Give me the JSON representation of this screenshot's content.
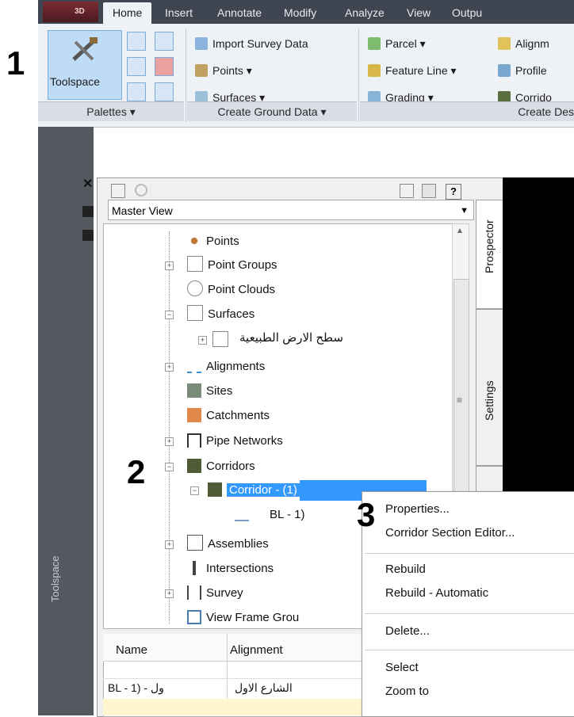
{
  "annotations": {
    "n1": "1",
    "n2": "2",
    "n3": "3"
  },
  "ribbon": {
    "app_badge": "3D",
    "tabs": [
      "Home",
      "Insert",
      "Annotate",
      "Modify",
      "Analyze",
      "View",
      "Outpu"
    ],
    "toolspace_label": "Toolspace",
    "create_ground": [
      "Import Survey Data",
      "Points ▾",
      "Surfaces ▾"
    ],
    "create_design": [
      "Parcel ▾",
      "Feature Line ▾",
      "Grading ▾"
    ],
    "create_design2": [
      "Alignm",
      "Profile",
      "Corrido"
    ],
    "panels": [
      "Palettes ▾",
      "Create Ground Data ▾",
      "Create Des"
    ]
  },
  "toolspace": {
    "strip_label": "Toolspace",
    "view_select": "Master View",
    "side_tabs": [
      "Prospector",
      "Settings"
    ],
    "tree": [
      "Points",
      "Point Groups",
      "Point Clouds",
      "Surfaces",
      "سطح الارض الطبيعية",
      "Alignments",
      "Sites",
      "Catchments",
      "Pipe Networks",
      "Corridors",
      "Corridor - (1)",
      "BL - 1)",
      "Assemblies",
      "Intersections",
      "Survey",
      "View Frame Grou"
    ],
    "grid": {
      "headers": [
        "Name",
        "Alignment"
      ],
      "row": [
        "BL - 1) - ول",
        "الشارع الاول"
      ]
    }
  },
  "context_menu": {
    "items": [
      "Properties...",
      "Corridor Section Editor...",
      "Rebuild",
      "Rebuild - Automatic",
      "Delete...",
      "Select",
      "Zoom to"
    ]
  },
  "colors": {
    "selection": "#3399ff",
    "tabbar": "#3f4652",
    "ribbon": "#eef1f5"
  }
}
